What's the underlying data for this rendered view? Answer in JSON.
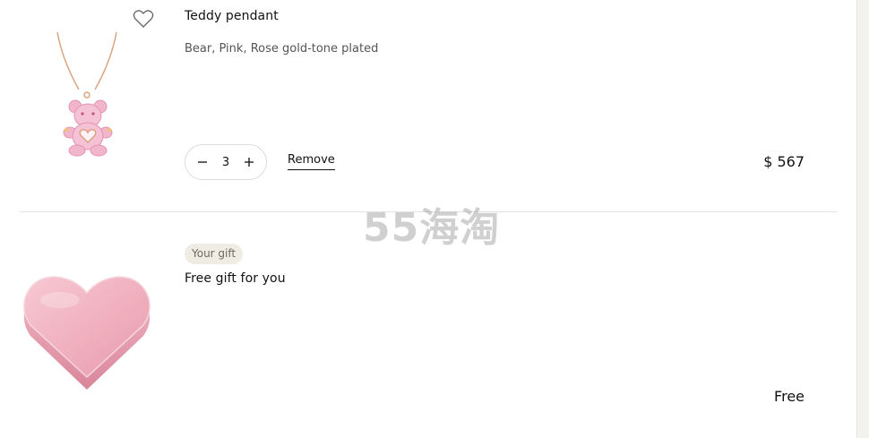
{
  "cart": {
    "items": [
      {
        "title": "Teddy pendant",
        "variant": "Bear, Pink, Rose gold-tone plated",
        "quantity": "3",
        "remove_label": "Remove",
        "price": "$ 567",
        "image_icon": "teddy-bear-pendant-icon",
        "wishlist_icon": "heart-outline-icon"
      },
      {
        "badge": "Your gift",
        "title": "Free gift for you",
        "price": "Free",
        "image_icon": "heart-box-icon"
      }
    ]
  },
  "watermark": "55海淘",
  "colors": {
    "rose_gold": "#d9a07a",
    "pink_stone": "#f2b6cc",
    "badge_bg": "#efece4",
    "divider": "#e2e2e2"
  }
}
